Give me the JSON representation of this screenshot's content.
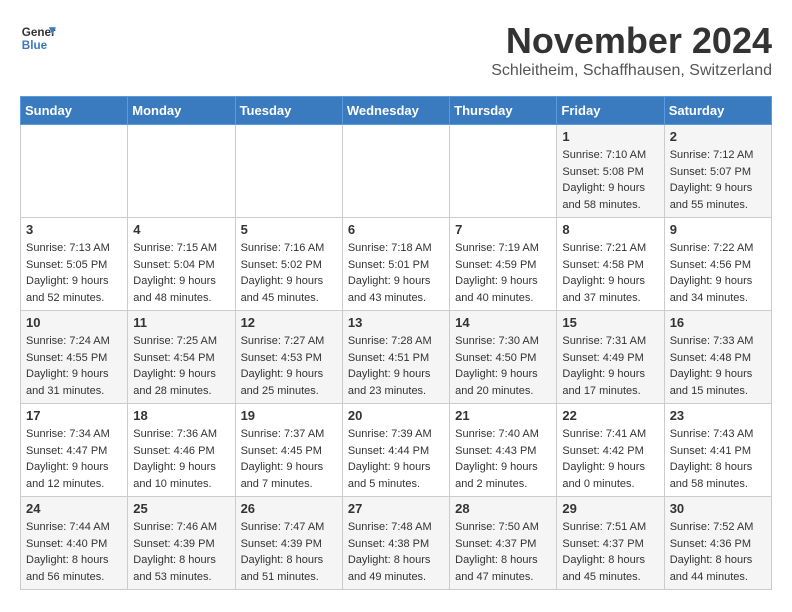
{
  "logo": {
    "line1": "General",
    "line2": "Blue"
  },
  "title": "November 2024",
  "location": "Schleitheim, Schaffhausen, Switzerland",
  "days_header": [
    "Sunday",
    "Monday",
    "Tuesday",
    "Wednesday",
    "Thursday",
    "Friday",
    "Saturday"
  ],
  "weeks": [
    [
      {
        "day": "",
        "sunrise": "",
        "sunset": "",
        "daylight": ""
      },
      {
        "day": "",
        "sunrise": "",
        "sunset": "",
        "daylight": ""
      },
      {
        "day": "",
        "sunrise": "",
        "sunset": "",
        "daylight": ""
      },
      {
        "day": "",
        "sunrise": "",
        "sunset": "",
        "daylight": ""
      },
      {
        "day": "",
        "sunrise": "",
        "sunset": "",
        "daylight": ""
      },
      {
        "day": "1",
        "sunrise": "Sunrise: 7:10 AM",
        "sunset": "Sunset: 5:08 PM",
        "daylight": "Daylight: 9 hours and 58 minutes."
      },
      {
        "day": "2",
        "sunrise": "Sunrise: 7:12 AM",
        "sunset": "Sunset: 5:07 PM",
        "daylight": "Daylight: 9 hours and 55 minutes."
      }
    ],
    [
      {
        "day": "3",
        "sunrise": "Sunrise: 7:13 AM",
        "sunset": "Sunset: 5:05 PM",
        "daylight": "Daylight: 9 hours and 52 minutes."
      },
      {
        "day": "4",
        "sunrise": "Sunrise: 7:15 AM",
        "sunset": "Sunset: 5:04 PM",
        "daylight": "Daylight: 9 hours and 48 minutes."
      },
      {
        "day": "5",
        "sunrise": "Sunrise: 7:16 AM",
        "sunset": "Sunset: 5:02 PM",
        "daylight": "Daylight: 9 hours and 45 minutes."
      },
      {
        "day": "6",
        "sunrise": "Sunrise: 7:18 AM",
        "sunset": "Sunset: 5:01 PM",
        "daylight": "Daylight: 9 hours and 43 minutes."
      },
      {
        "day": "7",
        "sunrise": "Sunrise: 7:19 AM",
        "sunset": "Sunset: 4:59 PM",
        "daylight": "Daylight: 9 hours and 40 minutes."
      },
      {
        "day": "8",
        "sunrise": "Sunrise: 7:21 AM",
        "sunset": "Sunset: 4:58 PM",
        "daylight": "Daylight: 9 hours and 37 minutes."
      },
      {
        "day": "9",
        "sunrise": "Sunrise: 7:22 AM",
        "sunset": "Sunset: 4:56 PM",
        "daylight": "Daylight: 9 hours and 34 minutes."
      }
    ],
    [
      {
        "day": "10",
        "sunrise": "Sunrise: 7:24 AM",
        "sunset": "Sunset: 4:55 PM",
        "daylight": "Daylight: 9 hours and 31 minutes."
      },
      {
        "day": "11",
        "sunrise": "Sunrise: 7:25 AM",
        "sunset": "Sunset: 4:54 PM",
        "daylight": "Daylight: 9 hours and 28 minutes."
      },
      {
        "day": "12",
        "sunrise": "Sunrise: 7:27 AM",
        "sunset": "Sunset: 4:53 PM",
        "daylight": "Daylight: 9 hours and 25 minutes."
      },
      {
        "day": "13",
        "sunrise": "Sunrise: 7:28 AM",
        "sunset": "Sunset: 4:51 PM",
        "daylight": "Daylight: 9 hours and 23 minutes."
      },
      {
        "day": "14",
        "sunrise": "Sunrise: 7:30 AM",
        "sunset": "Sunset: 4:50 PM",
        "daylight": "Daylight: 9 hours and 20 minutes."
      },
      {
        "day": "15",
        "sunrise": "Sunrise: 7:31 AM",
        "sunset": "Sunset: 4:49 PM",
        "daylight": "Daylight: 9 hours and 17 minutes."
      },
      {
        "day": "16",
        "sunrise": "Sunrise: 7:33 AM",
        "sunset": "Sunset: 4:48 PM",
        "daylight": "Daylight: 9 hours and 15 minutes."
      }
    ],
    [
      {
        "day": "17",
        "sunrise": "Sunrise: 7:34 AM",
        "sunset": "Sunset: 4:47 PM",
        "daylight": "Daylight: 9 hours and 12 minutes."
      },
      {
        "day": "18",
        "sunrise": "Sunrise: 7:36 AM",
        "sunset": "Sunset: 4:46 PM",
        "daylight": "Daylight: 9 hours and 10 minutes."
      },
      {
        "day": "19",
        "sunrise": "Sunrise: 7:37 AM",
        "sunset": "Sunset: 4:45 PM",
        "daylight": "Daylight: 9 hours and 7 minutes."
      },
      {
        "day": "20",
        "sunrise": "Sunrise: 7:39 AM",
        "sunset": "Sunset: 4:44 PM",
        "daylight": "Daylight: 9 hours and 5 minutes."
      },
      {
        "day": "21",
        "sunrise": "Sunrise: 7:40 AM",
        "sunset": "Sunset: 4:43 PM",
        "daylight": "Daylight: 9 hours and 2 minutes."
      },
      {
        "day": "22",
        "sunrise": "Sunrise: 7:41 AM",
        "sunset": "Sunset: 4:42 PM",
        "daylight": "Daylight: 9 hours and 0 minutes."
      },
      {
        "day": "23",
        "sunrise": "Sunrise: 7:43 AM",
        "sunset": "Sunset: 4:41 PM",
        "daylight": "Daylight: 8 hours and 58 minutes."
      }
    ],
    [
      {
        "day": "24",
        "sunrise": "Sunrise: 7:44 AM",
        "sunset": "Sunset: 4:40 PM",
        "daylight": "Daylight: 8 hours and 56 minutes."
      },
      {
        "day": "25",
        "sunrise": "Sunrise: 7:46 AM",
        "sunset": "Sunset: 4:39 PM",
        "daylight": "Daylight: 8 hours and 53 minutes."
      },
      {
        "day": "26",
        "sunrise": "Sunrise: 7:47 AM",
        "sunset": "Sunset: 4:39 PM",
        "daylight": "Daylight: 8 hours and 51 minutes."
      },
      {
        "day": "27",
        "sunrise": "Sunrise: 7:48 AM",
        "sunset": "Sunset: 4:38 PM",
        "daylight": "Daylight: 8 hours and 49 minutes."
      },
      {
        "day": "28",
        "sunrise": "Sunrise: 7:50 AM",
        "sunset": "Sunset: 4:37 PM",
        "daylight": "Daylight: 8 hours and 47 minutes."
      },
      {
        "day": "29",
        "sunrise": "Sunrise: 7:51 AM",
        "sunset": "Sunset: 4:37 PM",
        "daylight": "Daylight: 8 hours and 45 minutes."
      },
      {
        "day": "30",
        "sunrise": "Sunrise: 7:52 AM",
        "sunset": "Sunset: 4:36 PM",
        "daylight": "Daylight: 8 hours and 44 minutes."
      }
    ]
  ]
}
